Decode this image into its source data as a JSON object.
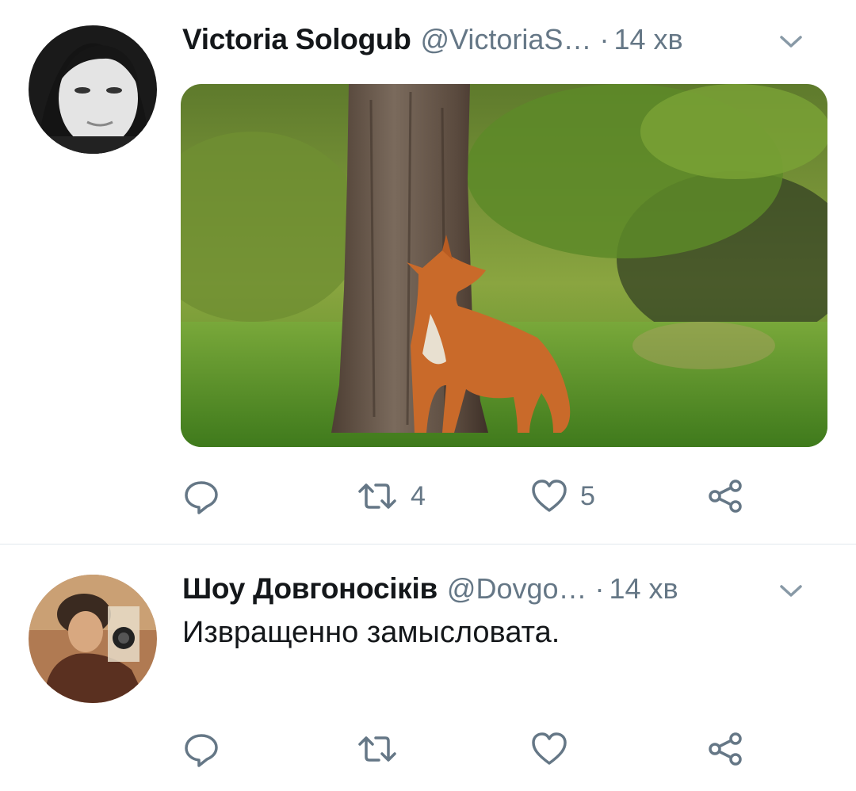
{
  "tweets": [
    {
      "author_name": "Victoria Sologub",
      "handle": "@VictoriaS…",
      "separator": "·",
      "time": "14 хв",
      "text": "",
      "retweets": "4",
      "likes": "5"
    },
    {
      "author_name": "Шоу Довгоносіків",
      "handle": "@Dovgo…",
      "separator": "·",
      "time": "14 хв",
      "text": "Извращенно замысловата.",
      "retweets": "",
      "likes": ""
    }
  ],
  "icons": {
    "reply": "reply-icon",
    "retweet": "retweet-icon",
    "like": "heart-icon",
    "share": "share-icon",
    "menu": "chevron-down-icon"
  },
  "colors": {
    "name": "#14171a",
    "meta": "#657786",
    "divider": "#e1e8ed"
  }
}
